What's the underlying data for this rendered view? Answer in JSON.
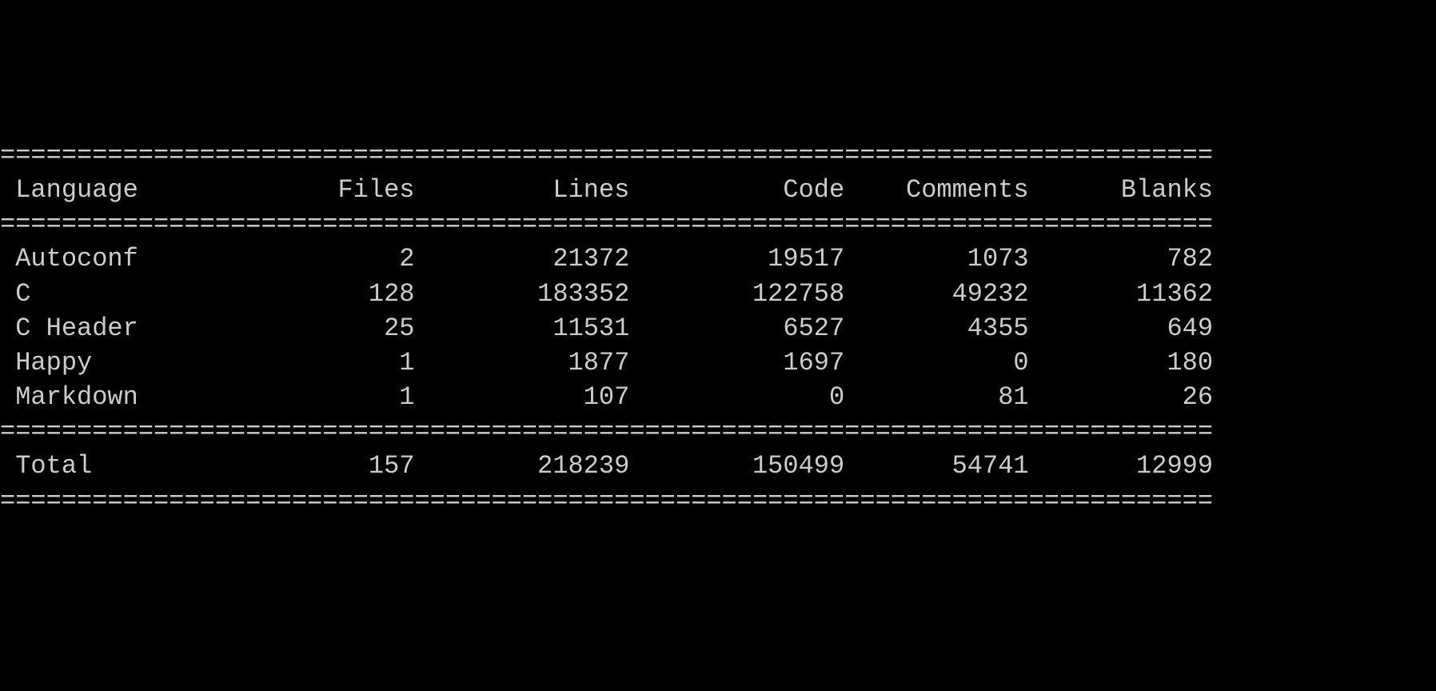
{
  "separator": "===============================================================================",
  "headers": {
    "language": "Language",
    "files": "Files",
    "lines": "Lines",
    "code": "Code",
    "comments": "Comments",
    "blanks": "Blanks"
  },
  "rows": [
    {
      "language": "Autoconf",
      "files": "2",
      "lines": "21372",
      "code": "19517",
      "comments": "1073",
      "blanks": "782"
    },
    {
      "language": "C",
      "files": "128",
      "lines": "183352",
      "code": "122758",
      "comments": "49232",
      "blanks": "11362"
    },
    {
      "language": "C Header",
      "files": "25",
      "lines": "11531",
      "code": "6527",
      "comments": "4355",
      "blanks": "649"
    },
    {
      "language": "Happy",
      "files": "1",
      "lines": "1877",
      "code": "1697",
      "comments": "0",
      "blanks": "180"
    },
    {
      "language": "Markdown",
      "files": "1",
      "lines": "107",
      "code": "0",
      "comments": "81",
      "blanks": "26"
    }
  ],
  "total": {
    "label": "Total",
    "files": "157",
    "lines": "218239",
    "code": "150499",
    "comments": "54741",
    "blanks": "12999"
  },
  "columns": {
    "language_width": 16,
    "files_width": 10,
    "lines_width": 14,
    "code_width": 14,
    "comments_width": 12,
    "blanks_width": 12
  }
}
